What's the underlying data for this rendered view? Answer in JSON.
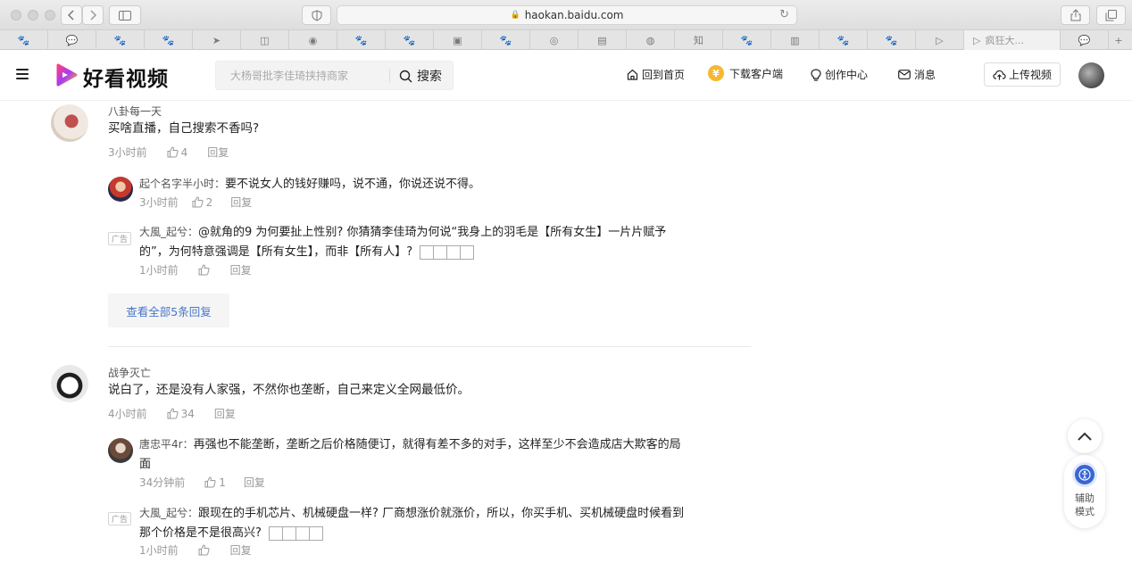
{
  "browser": {
    "url": "haokan.baidu.com",
    "active_tab_title": "疯狂大..."
  },
  "header": {
    "logo_text": "好看视频",
    "search_placeholder": "大杨哥批李佳琦挟持商家",
    "search_button": "搜索",
    "nav": {
      "home": "回到首页",
      "download": "下载客户端",
      "creator": "创作中心",
      "messages": "消息",
      "upload": "上传视频"
    },
    "download_coin_symbol": "¥"
  },
  "comments": [
    {
      "user": "八卦每一天",
      "text": "买啥直播，自己搜索不香吗?",
      "time": "3小时前",
      "likes": "4",
      "reply_label": "回复",
      "replies": [
        {
          "user": "起个名字半小时",
          "text": "要不说女人的钱好赚吗，说不通，你说还说不得。",
          "time": "3小时前",
          "likes": "2",
          "reply_label": "回复"
        },
        {
          "user": "大風_起兮",
          "ad_tag": "广告",
          "text_line1": "@就角的9 为何要扯上性别? 你猜猜李佳琦为何说“我身上的羽毛是【所有女生】一片片赋予",
          "text_line2": "的”，为何特意强调是【所有女生】，而非【所有人】?",
          "time": "1小时前",
          "reply_label": "回复"
        }
      ],
      "view_all": "查看全部5条回复"
    },
    {
      "user": "战争灭亡",
      "text": "说白了，还是没有人家强，不然你也垄断，自己来定义全网最低价。",
      "time": "4小时前",
      "likes": "34",
      "reply_label": "回复",
      "replies": [
        {
          "user": "唐忠平4r",
          "text_line1": "再强也不能垄断，垄断之后价格随便订，就得有差不多的对手，这样至少不会造成店大欺客的局",
          "text_line2": "面",
          "time": "34分钟前",
          "likes": "1",
          "reply_label": "回复"
        },
        {
          "user": "大風_起兮",
          "ad_tag": "广告",
          "text_line1": "跟现在的手机芯片、机械硬盘一样? 厂商想涨价就涨价，所以，你买手机、买机械硬盘时候看到",
          "text_line2": "那个价格是不是很高兴?",
          "time": "1小时前",
          "reply_label": "回复"
        }
      ]
    }
  ],
  "floating": {
    "assist_label": "辅助模式"
  }
}
